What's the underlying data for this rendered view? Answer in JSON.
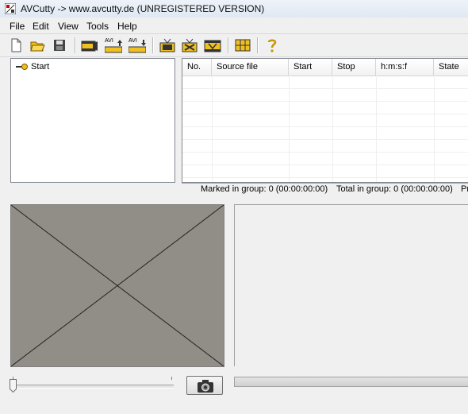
{
  "window": {
    "title": "AVCutty -> www.avcutty.de (UNREGISTERED VERSION)"
  },
  "menu": {
    "items": [
      "File",
      "Edit",
      "View",
      "Tools",
      "Help"
    ]
  },
  "toolbar": {
    "buttons": [
      {
        "icon": "new-file-icon"
      },
      {
        "icon": "open-folder-icon"
      },
      {
        "icon": "save-disk-icon"
      },
      {
        "icon": "film-import-icon"
      },
      {
        "icon": "avi-up-icon"
      },
      {
        "icon": "avi-down-icon"
      },
      {
        "icon": "tv-icon"
      },
      {
        "icon": "tv-cut-icon"
      },
      {
        "icon": "film-frame-icon"
      },
      {
        "icon": "grid-icon"
      },
      {
        "icon": "help-icon"
      }
    ],
    "avi_label": "AVI"
  },
  "tree": {
    "root_label": "Start"
  },
  "list": {
    "columns": [
      "No.",
      "Source file",
      "Start",
      "Stop",
      "h:m:s:f",
      "State"
    ],
    "rows": []
  },
  "status": {
    "marked": "Marked in group: 0 (00:00:00:00)",
    "total": "Total in group: 0 (00:00:00:00)",
    "truncated": "Pr"
  },
  "preview": {
    "placeholder": "empty-video-frame"
  },
  "controls": {
    "slider_position": 0,
    "snapshot_icon": "camera-icon",
    "progress": 0
  },
  "colors": {
    "video_bg": "#918e87",
    "accent": "#f0c020"
  }
}
